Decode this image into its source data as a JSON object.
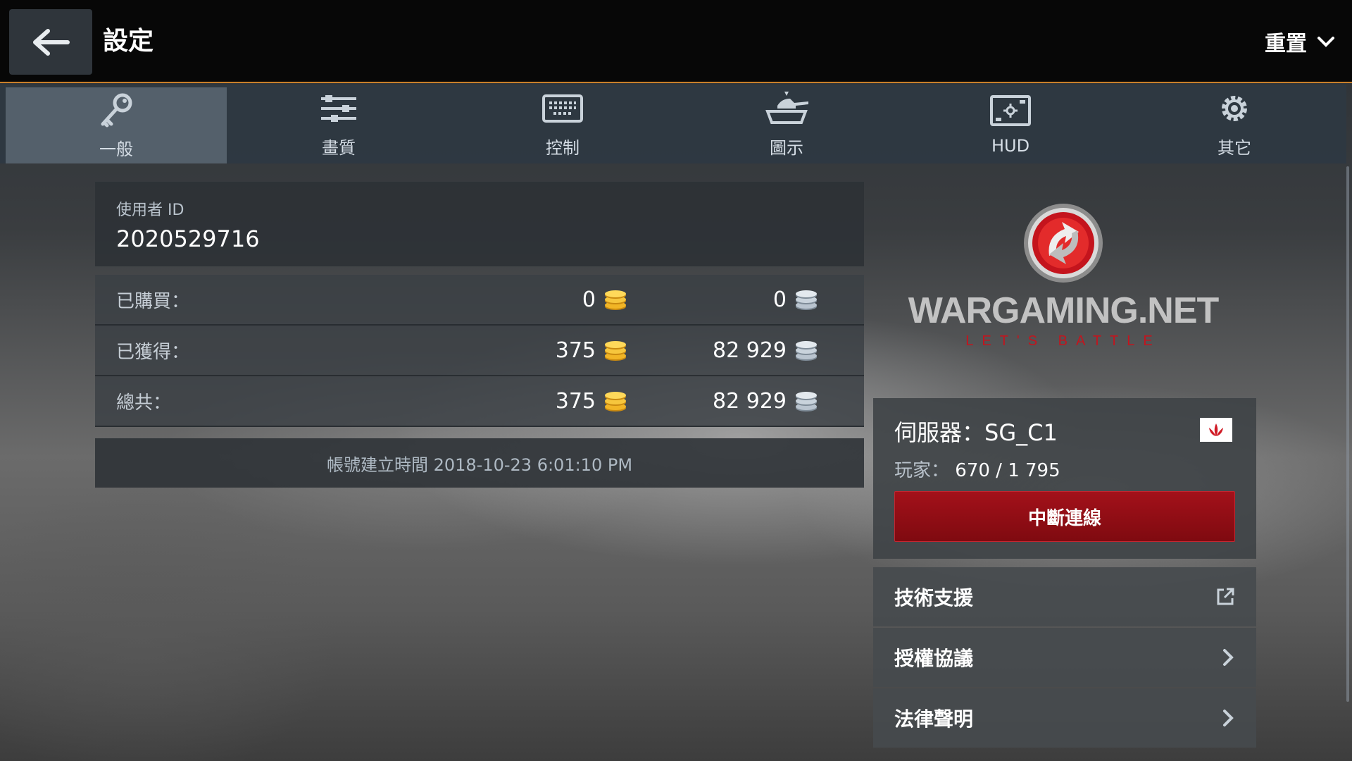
{
  "header": {
    "title": "設定",
    "reset_label": "重置"
  },
  "tabs": [
    {
      "label": "一般",
      "icon": "key-icon",
      "active": true
    },
    {
      "label": "畫質",
      "icon": "sliders-icon",
      "active": false
    },
    {
      "label": "控制",
      "icon": "keyboard-icon",
      "active": false
    },
    {
      "label": "圖示",
      "icon": "tank-icon",
      "active": false
    },
    {
      "label": "HUD",
      "icon": "hud-icon",
      "active": false
    },
    {
      "label": "其它",
      "icon": "gear-icon",
      "active": false
    }
  ],
  "account": {
    "user_id_label": "使用者 ID",
    "user_id": "2020529716",
    "rows": [
      {
        "label": "已購買：",
        "gold": "0",
        "silver": "0"
      },
      {
        "label": "已獲得：",
        "gold": "375",
        "silver": "82 929"
      },
      {
        "label": "總共：",
        "gold": "375",
        "silver": "82 929"
      }
    ],
    "created_text": "帳號建立時間 2018-10-23 6:01:10 PM"
  },
  "brand": {
    "name": "WARGAMING.NET",
    "tagline": "LET'S BATTLE",
    "accent": "#c4141d"
  },
  "server": {
    "name": "伺服器：SG_C1",
    "players_label": "玩家：",
    "players_value": "670 / 1 795",
    "disconnect_label": "中斷連線"
  },
  "menu": [
    {
      "label": "技術支援",
      "icon": "external-link-icon"
    },
    {
      "label": "授權協議",
      "icon": "chevron-right-icon"
    },
    {
      "label": "法律聲明",
      "icon": "chevron-right-icon"
    }
  ],
  "colors": {
    "topbar_border": "#c9802a",
    "disconnect_button": "#a3111a",
    "gold_coin": "#f1b526",
    "silver_coin": "#b9c4cf"
  }
}
